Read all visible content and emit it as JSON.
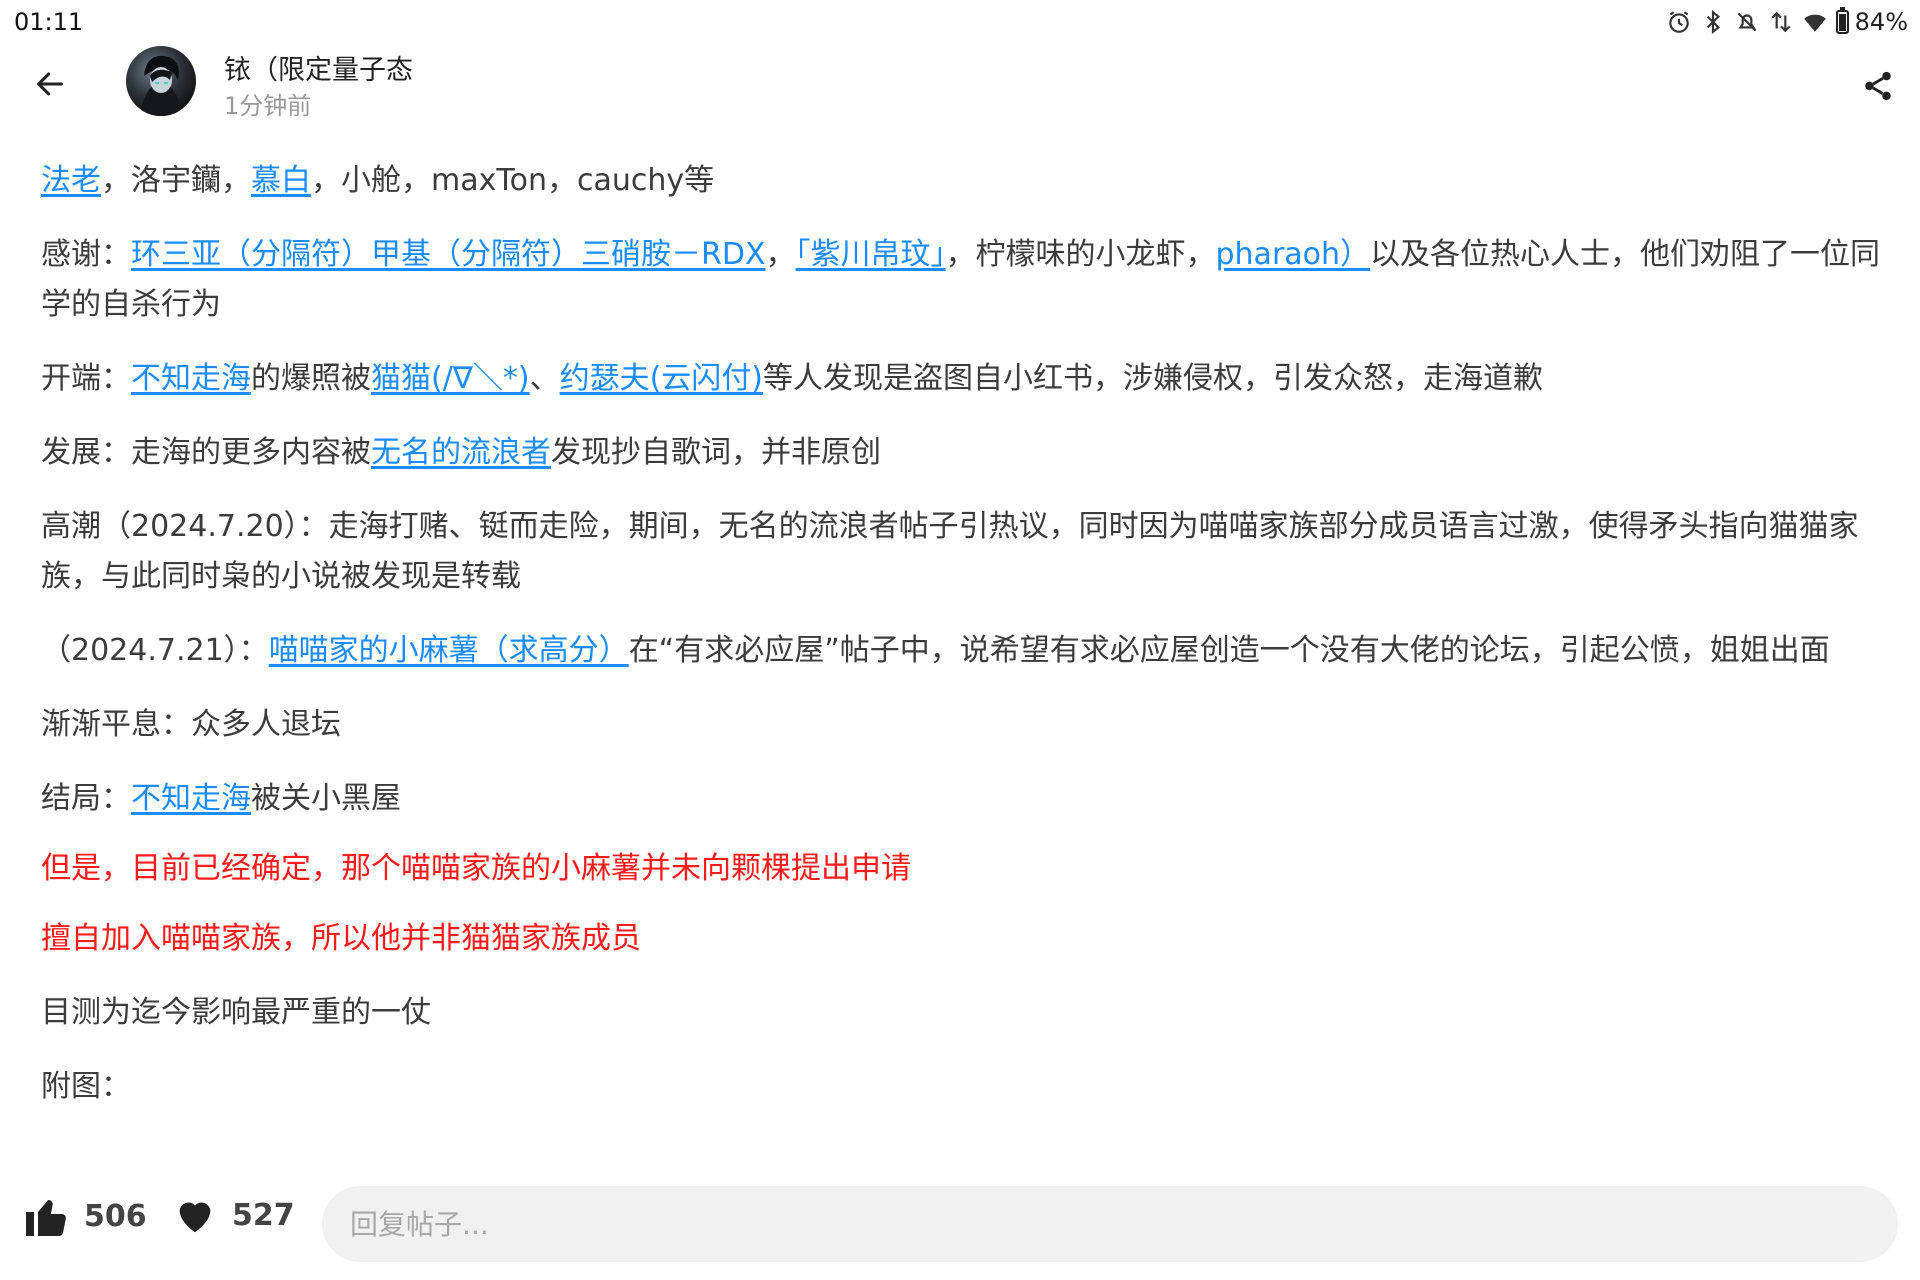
{
  "status_bar": {
    "time": "01:11",
    "battery": "84%",
    "battery_level": 0.84,
    "icons": [
      "alarm-icon",
      "bluetooth-icon",
      "mute-icon",
      "data-arrows-icon",
      "wifi-icon",
      "battery-icon"
    ]
  },
  "header": {
    "username": "铱（限定量子态",
    "time_ago": "1分钟前",
    "back_icon": "arrow-left-icon",
    "share_icon": "share-icon"
  },
  "content": {
    "p1": {
      "link_1": "法老",
      "text_1": "，洛宇钄，",
      "link_2": "慕白",
      "text_2": "，小舱，maxTon，cauchy等"
    },
    "p2": {
      "text_1": "感谢：",
      "link_1": "环三亚（分隔符）甲基（分隔符）三硝胺－RDX",
      "text_2": "，",
      "link_2": "「紫川帛玟」",
      "text_3": "，柠檬味的小龙虾，",
      "link_3": "pharaoh）",
      "text_4": "以及各位热心人士，他们劝阻了一位同学的自杀行为"
    },
    "p3": {
      "text_1": "开端：",
      "link_1": "不知走海",
      "text_2": "的爆照被",
      "link_2": "猫猫(/∇＼*)",
      "text_3": "、",
      "link_3": "约瑟夫(云闪付)",
      "text_4": "等人发现是盗图自小红书，涉嫌侵权，引发众怒，走海道歉"
    },
    "p4": {
      "text_1": "发展：走海的更多内容被",
      "link_1": "无名的流浪者",
      "text_2": "发现抄自歌词，并非原创"
    },
    "p5": {
      "text_1": "高潮（2024.7.20）：走海打赌、铤而走险，期间，无名的流浪者帖子引热议，同时因为喵喵家族部分成员语言过激，使得矛头指向猫猫家族，与此同时枭的小说被发现是转载"
    },
    "p6": {
      "text_1": "（2024.7.21）：",
      "link_1": "喵喵家的小麻薯（求高分）",
      "text_2": "在“有求必应屋”帖子中，说希望有求必应屋创造一个没有大佬的论坛，引起公愤，姐姐出面"
    },
    "p7": {
      "text_1": "渐渐平息：众多人退坛"
    },
    "p8": {
      "text_1": "结局：",
      "link_1": "不知走海",
      "text_2": "被关小黑屋"
    },
    "p9": {
      "text_1": "但是，目前已经确定，那个喵喵家族的小麻薯并未向颗棵提出申请"
    },
    "p10": {
      "text_1": "擅自加入喵喵家族，所以他并非猫猫家族成员"
    },
    "p11": {
      "text_1": "目测为迄今影响最严重的一仗"
    },
    "p12": {
      "text_1": "附图："
    }
  },
  "bottom_bar": {
    "like_count": "506",
    "favorite_count": "527",
    "reply_placeholder": "回复帖子..."
  },
  "colors": {
    "link": "#1a8cff",
    "emphasis_red": "#ff1a1a",
    "body_text": "#3c3c3c",
    "muted_text": "#9a9a9a",
    "input_bg": "#f1f1f1"
  }
}
